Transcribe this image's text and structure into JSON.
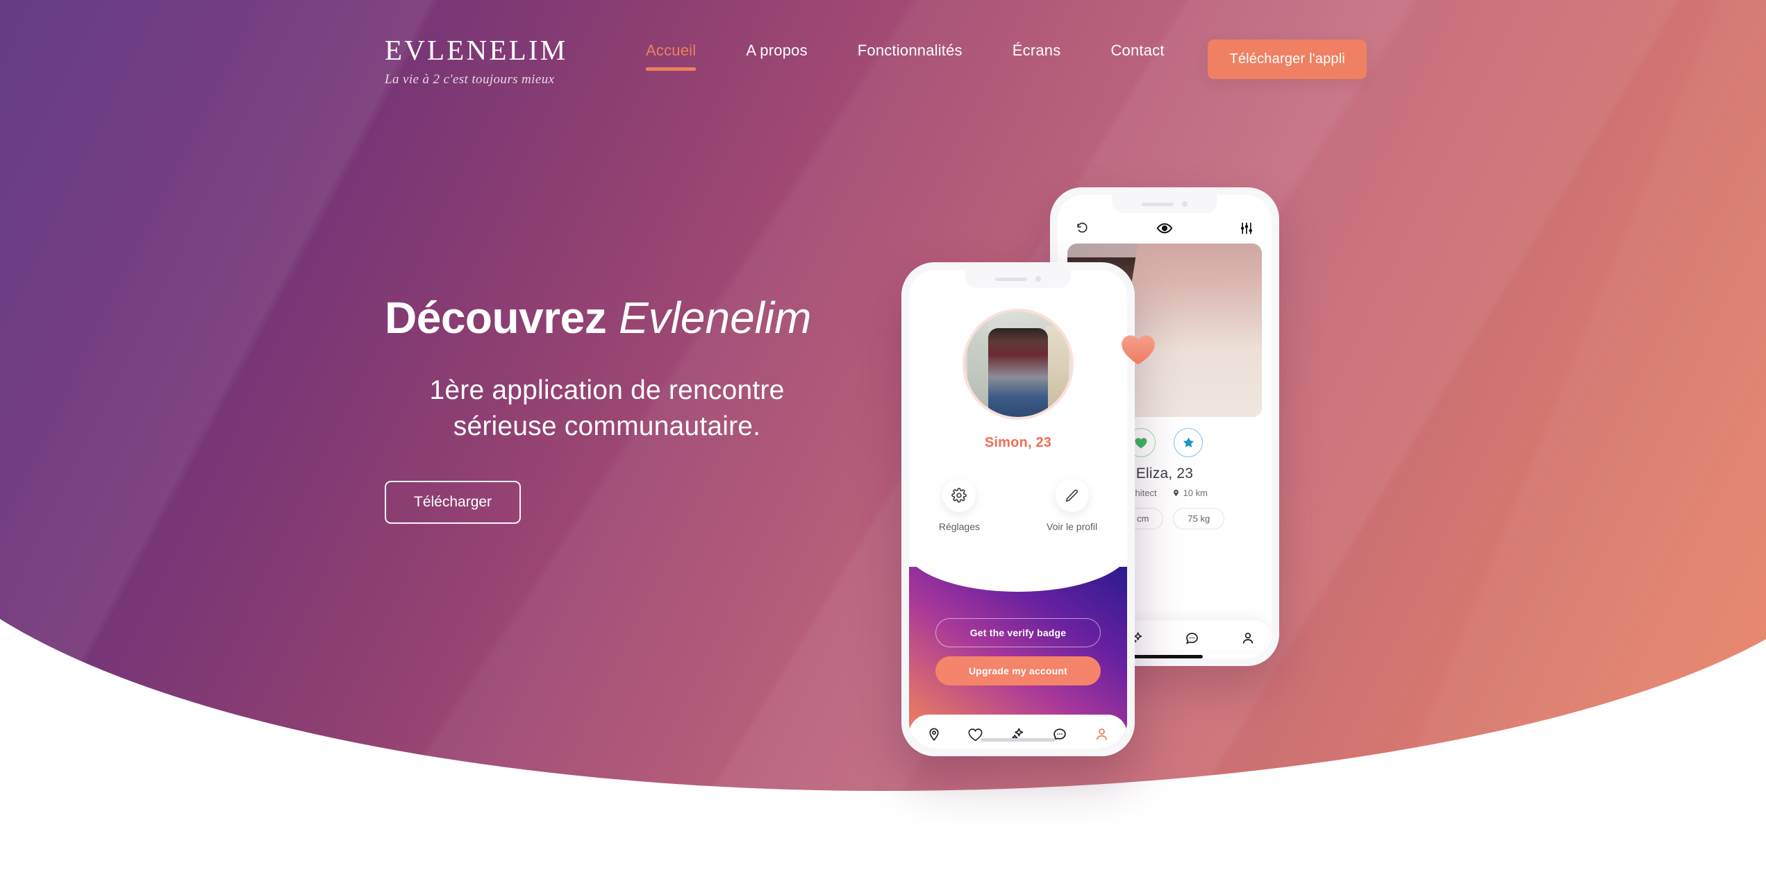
{
  "brand": {
    "name": "EVLENELIM",
    "tagline": "La vie à 2 c'est toujours mieux"
  },
  "nav": {
    "items": [
      {
        "label": "Accueil",
        "active": true
      },
      {
        "label": "A propos",
        "active": false
      },
      {
        "label": "Fonctionnalités",
        "active": false
      },
      {
        "label": "Écrans",
        "active": false
      },
      {
        "label": "Contact",
        "active": false
      }
    ],
    "cta_label": "Télécharger l'appli"
  },
  "hero": {
    "title_bold": "Découvrez",
    "title_italic": "Evlenelim",
    "subtitle": "1ère application de rencontre sérieuse communautaire.",
    "button_label": "Télécharger"
  },
  "phone_front": {
    "profile_name": "Simon, 23",
    "actions": [
      {
        "label": "Réglages",
        "icon": "gear-icon"
      },
      {
        "label": "Voir le profil",
        "icon": "pencil-icon"
      }
    ],
    "verify_button": "Get the verify badge",
    "upgrade_button": "Upgrade my account",
    "bottom_nav": [
      {
        "icon": "location-pin-icon",
        "active": false
      },
      {
        "icon": "heart-icon",
        "active": false
      },
      {
        "icon": "sparkle-icon",
        "active": false
      },
      {
        "icon": "chat-bubble-icon",
        "active": false
      },
      {
        "icon": "person-icon",
        "active": true
      }
    ]
  },
  "phone_back": {
    "top_icons": [
      {
        "icon": "undo-icon"
      },
      {
        "icon": "eye-icon"
      },
      {
        "icon": "sliders-icon"
      }
    ],
    "card_actions": [
      {
        "icon": "heart-filled-icon",
        "color": "#3cba63"
      },
      {
        "icon": "star-filled-icon",
        "color": "#1b93c9"
      }
    ],
    "profile_name": "Eliza, 23",
    "profile_job": "Architect",
    "profile_distance": "10 km",
    "pills": [
      "170 cm",
      "75 kg"
    ],
    "bottom_nav": [
      {
        "icon": "heart-icon"
      },
      {
        "icon": "sparkle-icon"
      },
      {
        "icon": "chat-bubble-icon"
      },
      {
        "icon": "person-icon"
      }
    ]
  },
  "colors": {
    "accent": "#ef7f5e",
    "gradient_start": "#4b2b7f",
    "gradient_end": "#ee8a63",
    "panel_indigo": "#2b1b8e"
  }
}
